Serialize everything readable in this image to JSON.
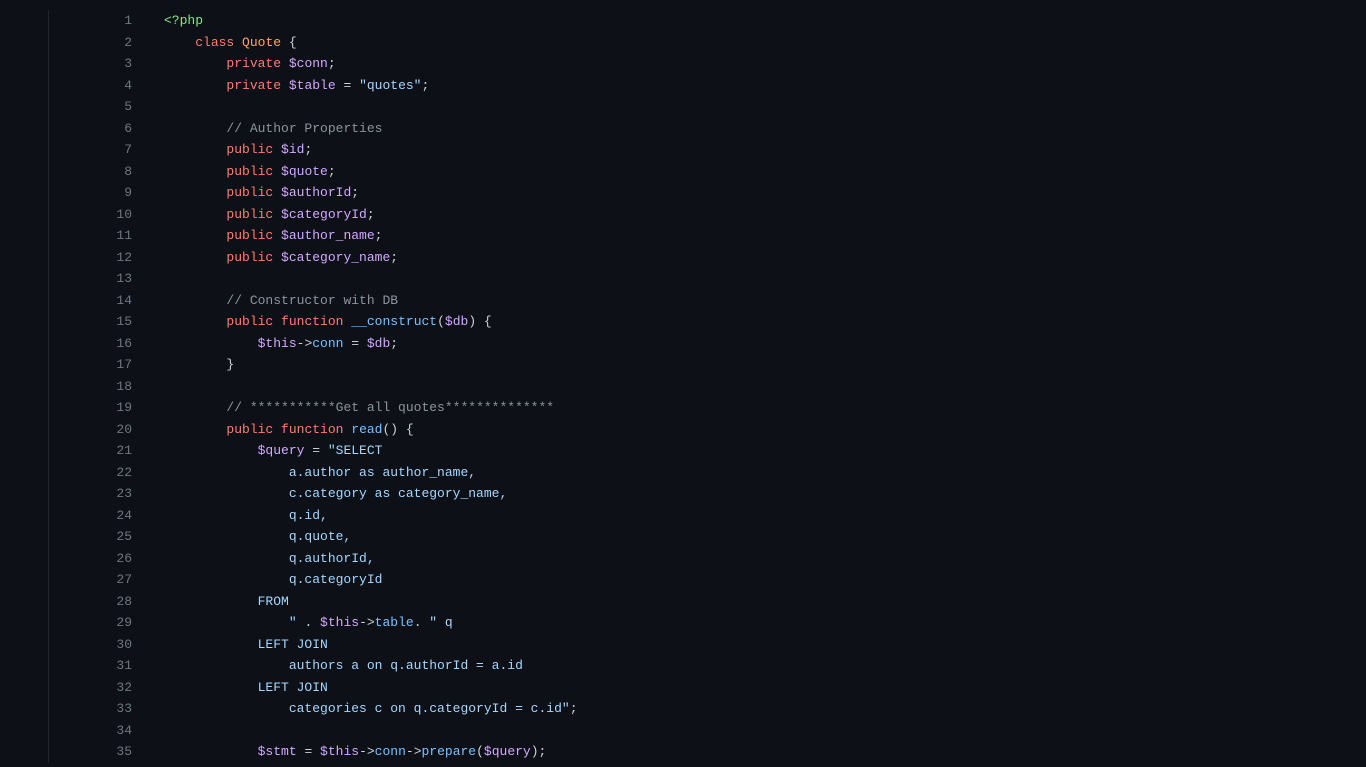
{
  "editor": {
    "lineStart": 1,
    "lineCount": 35
  },
  "code": {
    "l1_tag": "<?php",
    "l2_kw1": "class",
    "l2_cls": "Quote",
    "l2_p": " {",
    "l3_kw": "private",
    "l3_sig": "$conn",
    "l3_p": ";",
    "l4_kw": "private",
    "l4_sig": "$table",
    "l4_eq": " = ",
    "l4_str": "\"quotes\"",
    "l4_p": ";",
    "l6_cmt": "// Author Properties",
    "l7_kw": "public",
    "l7_sig": "$id",
    "l7_p": ";",
    "l8_kw": "public",
    "l8_sig": "$quote",
    "l8_p": ";",
    "l9_kw": "public",
    "l9_sig": "$authorId",
    "l9_p": ";",
    "l10_kw": "public",
    "l10_sig": "$categoryId",
    "l10_p": ";",
    "l11_kw": "public",
    "l11_sig": "$author_name",
    "l11_p": ";",
    "l12_kw": "public",
    "l12_sig": "$category_name",
    "l12_p": ";",
    "l14_cmt": "// Constructor with DB",
    "l15_kw1": "public",
    "l15_kw2": "function",
    "l15_fn": "__construct",
    "l15_po": "(",
    "l15_arg": "$db",
    "l15_pc": ") {",
    "l16_sig": "$this",
    "l16_ar": "->",
    "l16_prop": "conn",
    "l16_eq": " = ",
    "l16_sig2": "$db",
    "l16_p": ";",
    "l17_p": "}",
    "l19_cmt": "// ***********Get all quotes**************",
    "l20_kw1": "public",
    "l20_kw2": "function",
    "l20_fn": "read",
    "l20_p": "() {",
    "l21_sig": "$query",
    "l21_eq": " = ",
    "l21_str": "\"SELECT",
    "l22_str": "a.author as author_name,",
    "l23_str": "c.category as category_name,",
    "l24_str": "q.id,",
    "l25_str": "q.quote,",
    "l26_str": "q.authorId,",
    "l27_str": "q.categoryId",
    "l28_str": "FROM",
    "l29_str1": "\"",
    "l29_dot": " . ",
    "l29_sig": "$this",
    "l29_ar": "->",
    "l29_prop": "table",
    "l29_dot2": ". ",
    "l29_str2": "\" q",
    "l30_str": "LEFT JOIN",
    "l31_str": "authors a on q.authorId = a.id",
    "l32_str": "LEFT JOIN",
    "l33_str": "categories c on q.categoryId = c.id\"",
    "l33_p": ";",
    "l35_sig1": "$stmt",
    "l35_eq": " = ",
    "l35_sig2": "$this",
    "l35_ar": "->",
    "l35_prop": "conn",
    "l35_ar2": "->",
    "l35_fn": "prepare",
    "l35_po": "(",
    "l35_arg": "$query",
    "l35_pc": ");"
  }
}
